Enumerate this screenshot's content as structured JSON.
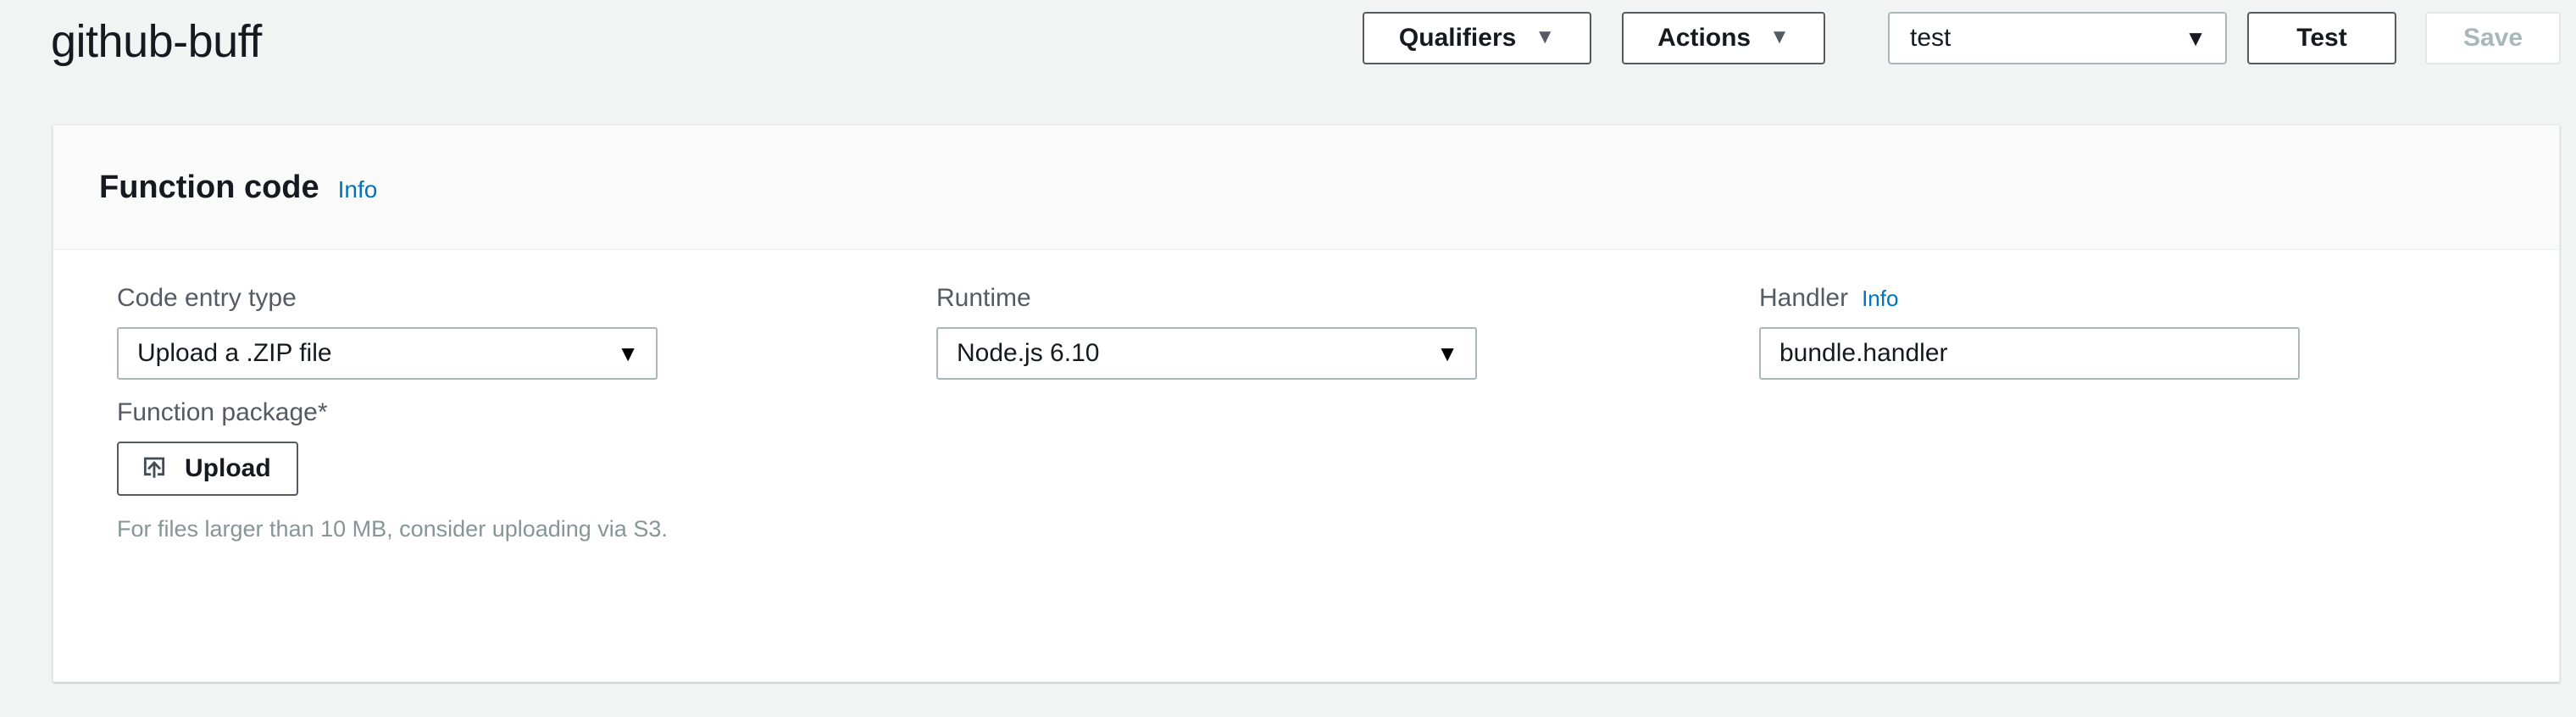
{
  "header": {
    "title": "github-buff",
    "qualifiers_label": "Qualifiers",
    "actions_label": "Actions",
    "caret_glyph": "▼",
    "test_select_value": "test",
    "test_button_label": "Test",
    "save_button_label": "Save"
  },
  "card": {
    "title": "Function code",
    "info_label": "Info"
  },
  "form": {
    "code_entry_type": {
      "label": "Code entry type",
      "value": "Upload a .ZIP file"
    },
    "runtime": {
      "label": "Runtime",
      "value": "Node.js 6.10"
    },
    "handler": {
      "label": "Handler",
      "info_label": "Info",
      "value": "bundle.handler",
      "placeholder": "bundle.handler"
    },
    "function_package": {
      "label": "Function package*",
      "upload_label": "Upload",
      "upload_icon": "upload-icon",
      "helper_text": "For files larger than 10 MB, consider uploading via S3."
    }
  },
  "colors": {
    "page_background": "#f2f3f3",
    "card_background": "#ffffff",
    "card_header_background": "#fafafa",
    "link_blue": "#0073bb",
    "label_gray": "#545b64",
    "border_gray": "#aab7b8",
    "disabled_text": "#aab7b8",
    "helper_text": "#879596",
    "text_primary": "#16191f"
  }
}
